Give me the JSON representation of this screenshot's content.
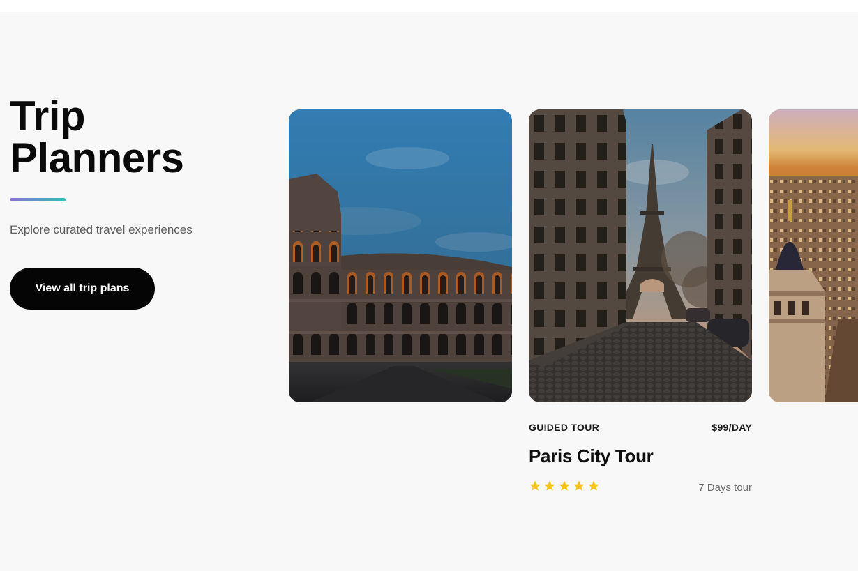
{
  "hero": {
    "title_line1": "Trip",
    "title_line2": "Planners",
    "subtitle": "Explore curated travel experiences",
    "cta_label": "View all trip plans"
  },
  "colors": {
    "accent_start": "#8a6fd6",
    "accent_end": "#2fc0b7",
    "cta_background": "#050505",
    "star": "#f5c518"
  },
  "cards": [
    {
      "image": "colosseum-rome"
    },
    {
      "image": "eiffel-tower-paris",
      "type": "GUIDED TOUR",
      "price": "$99/DAY",
      "name": "Paris City Tour",
      "rating": 5,
      "duration": "7 Days tour"
    },
    {
      "image": "city-skyline-dome"
    }
  ]
}
